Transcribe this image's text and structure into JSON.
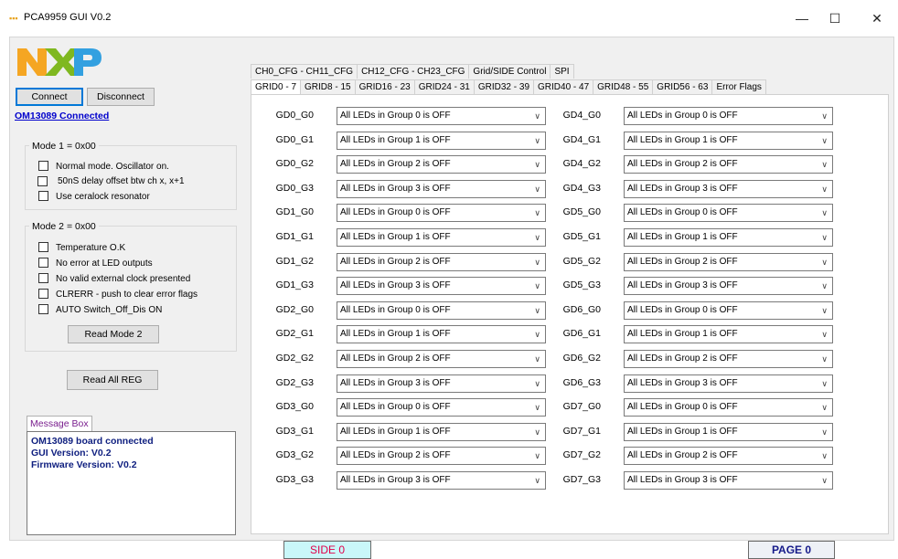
{
  "window": {
    "title": "PCA9959 GUI V0.2",
    "minimize": "—",
    "maximize": "☐",
    "close": "✕",
    "app_icon": "nxp-mini-logo"
  },
  "brand": {
    "colors": {
      "n": "#f5a623",
      "x": "#7fb820",
      "p": "#33a0e0"
    }
  },
  "connection": {
    "connect_label": "Connect",
    "disconnect_label": "Disconnect",
    "status": "OM13089 Connected"
  },
  "mode1": {
    "title": "Mode 1 = 0x00",
    "options": [
      "Normal mode. Oscillator on.",
      "50nS delay offset btw ch x, x+1",
      "Use ceralock resonator"
    ]
  },
  "mode2": {
    "title": "Mode 2 = 0x00",
    "options": [
      "Temperature O.K",
      "No error at LED outputs",
      "No valid external clock presented",
      "CLRERR - push to clear error flags",
      "AUTO Switch_Off_Dis ON"
    ],
    "read_label": "Read Mode 2"
  },
  "read_all_label": "Read All REG",
  "message_box": {
    "label": "Message Box",
    "lines": [
      "OM13089 board connected",
      "GUI Version: V0.2",
      "Firmware Version: V0.2"
    ]
  },
  "tabs_row1": [
    "CH0_CFG - CH11_CFG",
    "CH12_CFG - CH23_CFG",
    "Grid/SIDE Control",
    "SPI"
  ],
  "tabs_row2": [
    "GRID0 - 7",
    "GRID8 - 15",
    "GRID16 - 23",
    "GRID24 - 31",
    "GRID32 - 39",
    "GRID40 - 47",
    "GRID48 - 55",
    "GRID56 - 63",
    "Error Flags"
  ],
  "left_grid": [
    {
      "label": "GD0_G0",
      "value": "All LEDs in Group 0 is OFF"
    },
    {
      "label": "GD0_G1",
      "value": "All LEDs in Group 1 is OFF"
    },
    {
      "label": "GD0_G2",
      "value": "All LEDs in Group 2 is OFF"
    },
    {
      "label": "GD0_G3",
      "value": "All LEDs in Group 3 is OFF"
    },
    {
      "label": "GD1_G0",
      "value": "All LEDs in Group 0 is OFF"
    },
    {
      "label": "GD1_G1",
      "value": "All LEDs in Group 1 is OFF"
    },
    {
      "label": "GD1_G2",
      "value": "All LEDs in Group 2 is OFF"
    },
    {
      "label": "GD1_G3",
      "value": "All LEDs in Group 3 is OFF"
    },
    {
      "label": "GD2_G0",
      "value": "All LEDs in Group 0 is OFF"
    },
    {
      "label": "GD2_G1",
      "value": "All LEDs in Group 1 is OFF"
    },
    {
      "label": "GD2_G2",
      "value": "All LEDs in Group 2 is OFF"
    },
    {
      "label": "GD2_G3",
      "value": "All LEDs in Group 3 is OFF"
    },
    {
      "label": "GD3_G0",
      "value": "All LEDs in Group 0 is OFF"
    },
    {
      "label": "GD3_G1",
      "value": "All LEDs in Group 1 is OFF"
    },
    {
      "label": "GD3_G2",
      "value": "All LEDs in Group 2 is OFF"
    },
    {
      "label": "GD3_G3",
      "value": "All LEDs in Group 3 is OFF"
    }
  ],
  "right_grid": [
    {
      "label": "GD4_G0",
      "value": "All LEDs in Group 0 is OFF"
    },
    {
      "label": "GD4_G1",
      "value": "All LEDs in Group 1 is OFF"
    },
    {
      "label": "GD4_G2",
      "value": "All LEDs in Group 2 is OFF"
    },
    {
      "label": "GD4_G3",
      "value": "All LEDs in Group 3 is OFF"
    },
    {
      "label": "GD5_G0",
      "value": "All LEDs in Group 0 is OFF"
    },
    {
      "label": "GD5_G1",
      "value": "All LEDs in Group 1 is OFF"
    },
    {
      "label": "GD5_G2",
      "value": "All LEDs in Group 2 is OFF"
    },
    {
      "label": "GD5_G3",
      "value": "All LEDs in Group 3 is OFF"
    },
    {
      "label": "GD6_G0",
      "value": "All LEDs in Group 0 is OFF"
    },
    {
      "label": "GD6_G1",
      "value": "All LEDs in Group 1 is OFF"
    },
    {
      "label": "GD6_G2",
      "value": "All LEDs in Group 2 is OFF"
    },
    {
      "label": "GD6_G3",
      "value": "All LEDs in Group 3 is OFF"
    },
    {
      "label": "GD7_G0",
      "value": "All LEDs in Group 0 is OFF"
    },
    {
      "label": "GD7_G1",
      "value": "All LEDs in Group 1 is OFF"
    },
    {
      "label": "GD7_G2",
      "value": "All LEDs in Group 2 is OFF"
    },
    {
      "label": "GD7_G3",
      "value": "All LEDs in Group 3 is OFF"
    }
  ],
  "side_label": "SIDE 0",
  "page_label": "PAGE 0"
}
